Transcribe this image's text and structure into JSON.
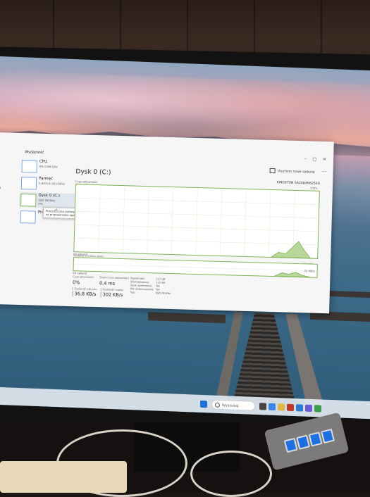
{
  "window": {
    "title": "Wydajność",
    "run_task_label": "Uruchom nowe zadanie",
    "more_label": "...",
    "controls": [
      "–",
      "□",
      "✕"
    ]
  },
  "nav_left_text": "tu",
  "perf_list": [
    {
      "name": "CPU",
      "sub": "0% 0,94 GHz",
      "sub2": ""
    },
    {
      "name": "Pamięć",
      "sub": "2,9/15,9 GB (18%)",
      "sub2": ""
    },
    {
      "name": "Dysk 0 (C:)",
      "sub": "SSD (NVMe)",
      "sub2": "0%"
    },
    {
      "name": "Proc",
      "sub": "",
      "sub2": ""
    }
  ],
  "tooltip": "Procent czasu poświęconego przez NVE dysk na przetwarzanie żądań odczytu lub zapisu",
  "main": {
    "title": "Dysk 0 (C:)",
    "model": "KINGSTON SA2000M8250G",
    "graph1_label": "Czas aktywności",
    "graph1_max": "100%",
    "graph1_time": "60 sekund",
    "graph2_label": "Szybkość transferu dysku",
    "graph2_max": "100 MB/s",
    "graph2_mid": "50 MB/s",
    "graph2_time": "60 sekund"
  },
  "stats": {
    "active_time_label": "Czas aktywności",
    "active_time_value": "0%",
    "response_label": "Średni czas odpowiedzi",
    "response_value": "0,4 ms",
    "read_label": "Szybkość odczytu",
    "read_value": "36,8 KB/s",
    "write_label": "Szybkość zapisu",
    "write_value": "302 KB/s",
    "props": [
      {
        "k": "Pojemność:",
        "v": "233 GB"
      },
      {
        "k": "Sformatowany:",
        "v": "233 GB"
      },
      {
        "k": "Dysk systemowy:",
        "v": "Tak"
      },
      {
        "k": "Plik stronicowania:",
        "v": "Tak"
      },
      {
        "k": "Typ:",
        "v": "SSD (NVMe)"
      }
    ]
  },
  "taskbar": {
    "search_placeholder": "Wyszukaj"
  },
  "colors": {
    "graph_border": "#7fb159",
    "graph_fill": "#b7d89a",
    "selection": "#dfe6ee"
  }
}
